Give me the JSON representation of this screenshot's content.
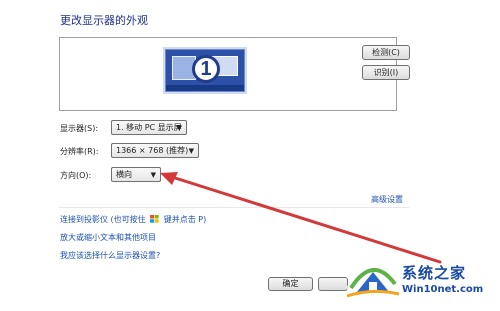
{
  "title": "更改显示器的外观",
  "preview": {
    "monitor_number": "1"
  },
  "buttons": {
    "detect": "检测(C)",
    "identify": "识别(I)",
    "ok": "确定"
  },
  "display": {
    "label": "显示器(S):",
    "value": "1. 移动 PC 显示屏"
  },
  "resolution": {
    "label": "分辨率(R):",
    "value": "1366 × 768 (推荐)"
  },
  "orientation": {
    "label": "方向(O):",
    "value": "横向"
  },
  "advanced_link": "高级设置",
  "links": {
    "projector_prefix": "连接到投影仪 (也可按住",
    "projector_suffix": "键并点击 P)",
    "text_size": "放大或缩小文本和其他项目",
    "which_setting": "我应该选择什么显示器设置?"
  },
  "watermark": {
    "site_name": "系统之家",
    "url": "Win10net.com"
  },
  "colors": {
    "title": "#1e3287",
    "link": "#1c51b1",
    "arrow": "#d23a3a"
  }
}
